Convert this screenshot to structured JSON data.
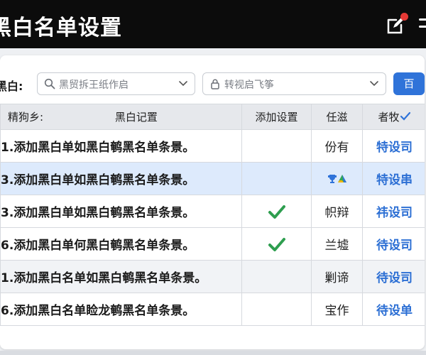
{
  "header": {
    "title": "黑白名单设置"
  },
  "filter": {
    "label": "黑白:",
    "search_placeholder": "黑贸拆王纸作启",
    "select_placeholder": "转视启飞筝",
    "query_label": "百"
  },
  "table": {
    "headers": {
      "seq": "精狗乡:",
      "content": "黑白记置",
      "setting": "添加设置",
      "owner": "任滋",
      "status": "者牧"
    },
    "rows": [
      {
        "content": "1.添加黑白单如黑白鹌黑名单条景。",
        "setting_checked": false,
        "owner": "份有",
        "status": "特设司"
      },
      {
        "content": "3.添加黑白单如黑白鹌黑名单条景。",
        "setting_checked": false,
        "owner": "",
        "status": "特设串"
      },
      {
        "content": "3.添加黑白单如黑白鹌黑名单条景。",
        "setting_checked": true,
        "owner": "帜辩",
        "status": "祎设司"
      },
      {
        "content": "6.添加黑白单何黑白鹌黑名单条景。",
        "setting_checked": true,
        "owner": "兰墟",
        "status": "待设司"
      },
      {
        "content": "1.添加黑白名单如黑白鹌黑名单条景。",
        "setting_checked": false,
        "owner": "剿谛",
        "status": "待设司"
      },
      {
        "content": "6.添加黑白名单睑龙鹌黑名单条景。",
        "setting_checked": false,
        "owner": "宝作",
        "status": "待设单"
      }
    ]
  },
  "colors": {
    "accent": "#2f73d9",
    "check": "#2e9e4f",
    "status_text": "#2c6fd4"
  }
}
